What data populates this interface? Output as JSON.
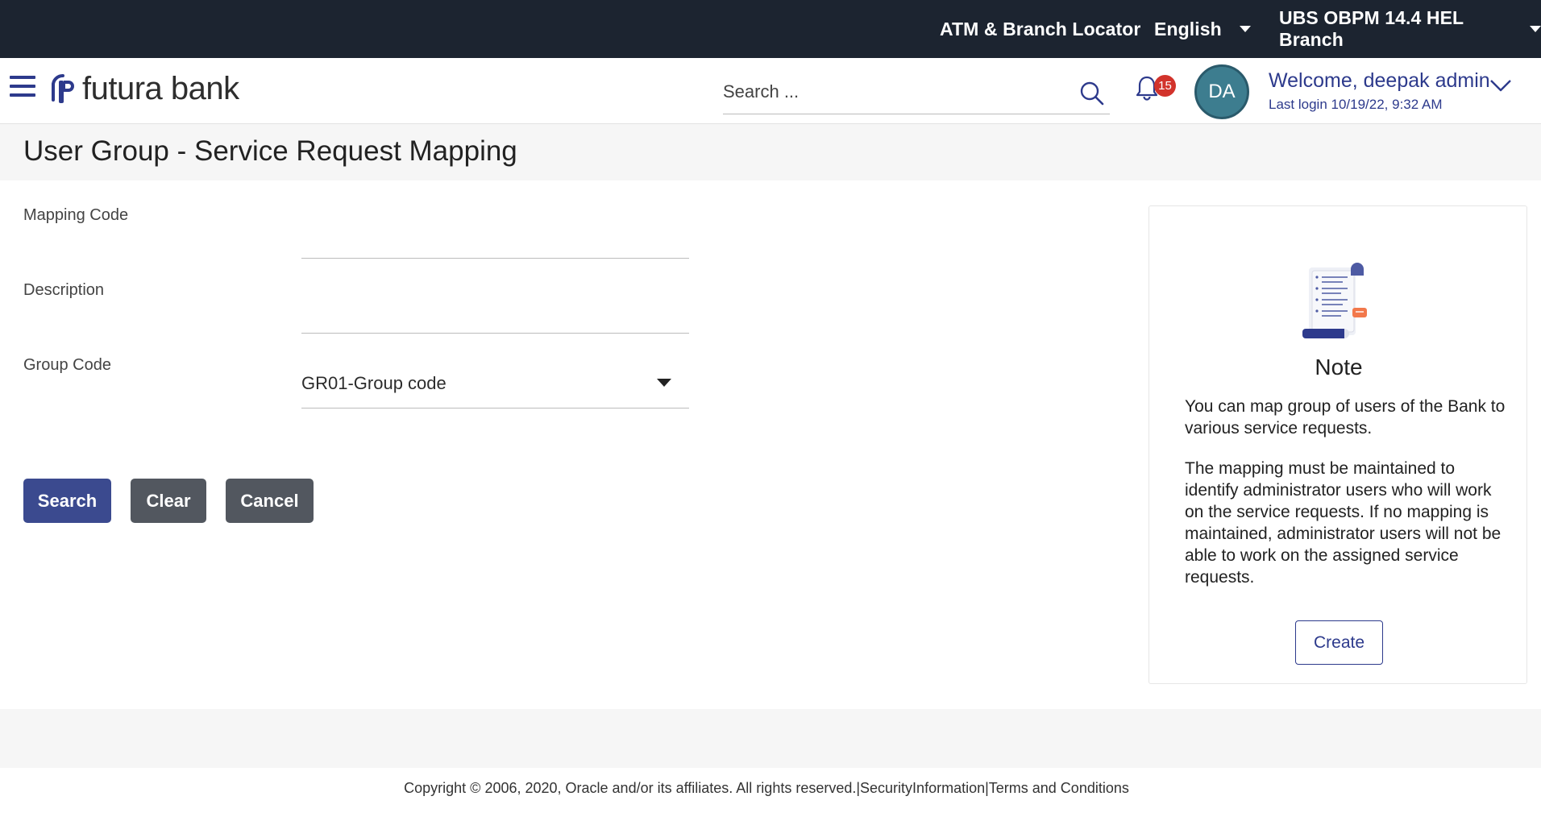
{
  "topbar": {
    "atm_locator": "ATM & Branch Locator",
    "language": "English",
    "branch": "UBS OBPM 14.4 HEL Branch"
  },
  "header": {
    "brand": "futura bank",
    "search_placeholder": "Search ...",
    "notification_count": "15",
    "avatar_initials": "DA",
    "welcome": "Welcome, deepak admin",
    "last_login": "Last login 10/19/22, 9:32 AM"
  },
  "page": {
    "title": "User Group - Service Request Mapping"
  },
  "form": {
    "mapping_code_label": "Mapping Code",
    "mapping_code_value": "",
    "description_label": "Description",
    "description_value": "",
    "group_code_label": "Group Code",
    "group_code_selected": "GR01-Group code"
  },
  "buttons": {
    "search": "Search",
    "clear": "Clear",
    "cancel": "Cancel"
  },
  "note": {
    "title": "Note",
    "para1": "You can map group of users of the Bank to various service requests.",
    "para2": "The mapping must be maintained to identify administrator users who will work on the service requests. If no mapping is maintained, administrator users will not be able to work on the assigned service requests.",
    "create": "Create"
  },
  "footer": {
    "copyright": "Copyright © 2006, 2020, Oracle and/or its affiliates. All rights reserved.|SecurityInformation|Terms and Conditions"
  },
  "colors": {
    "topbar_bg": "#1c2430",
    "brand_blue": "#2d3a8c",
    "search_button": "#3b4a8f",
    "secondary_button": "#52575f",
    "badge_red": "#d2332b"
  },
  "icons": [
    "menu-icon",
    "brand-logo",
    "search-icon",
    "bell-icon",
    "chevron-down-icon",
    "caret-down-icon",
    "note-illustration"
  ]
}
